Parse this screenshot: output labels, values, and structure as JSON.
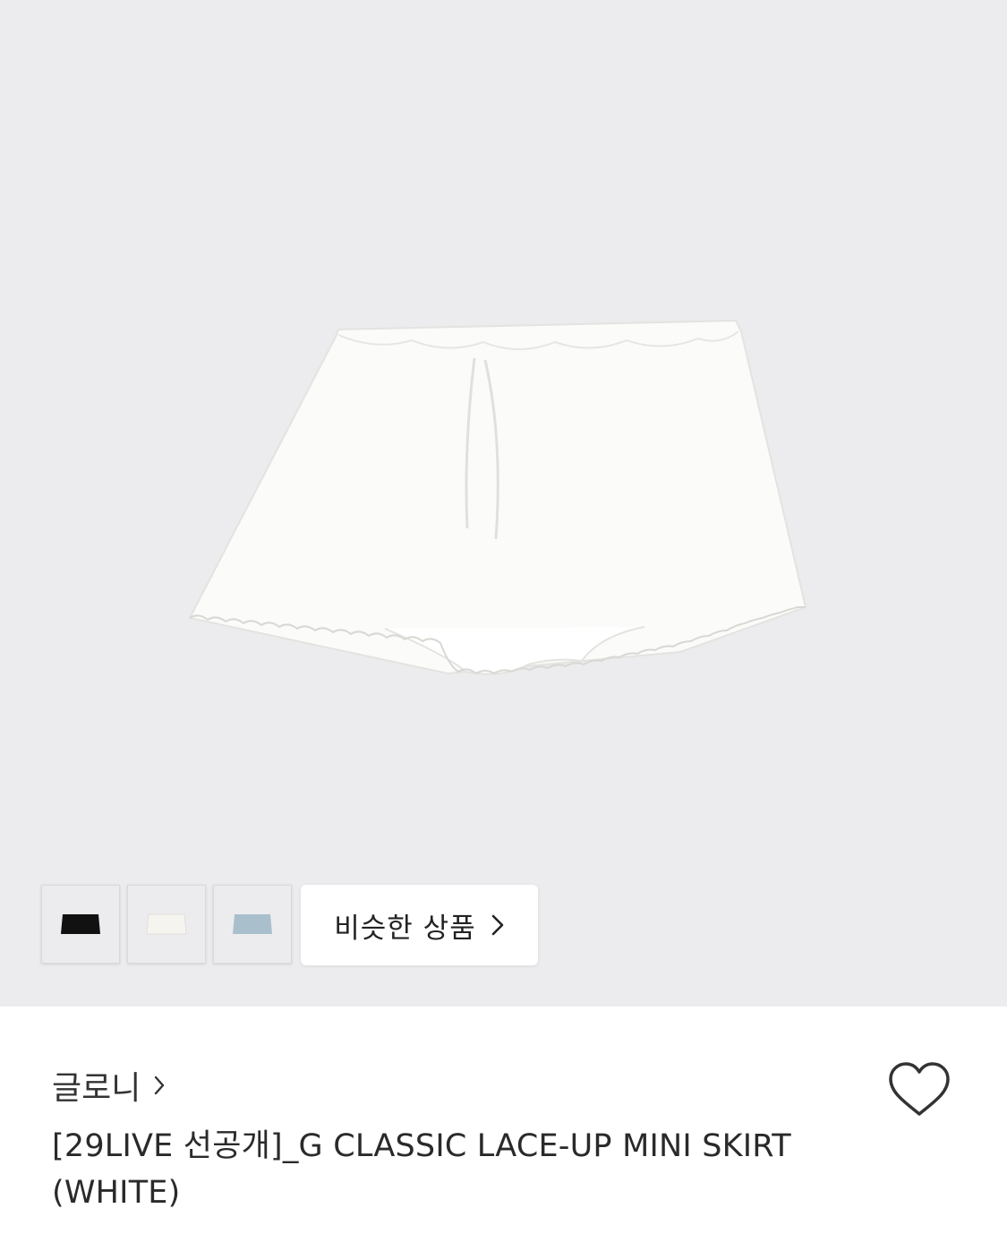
{
  "gallery": {
    "similar_label": "비슷한 상품",
    "thumbnails": [
      {
        "color": "#111111"
      },
      {
        "color": "#f6f4ef"
      },
      {
        "color": "#a9bfcc"
      }
    ],
    "background": "#ececee"
  },
  "product": {
    "brand": "글로니",
    "title": "[29LIVE 선공개]_G CLASSIC LACE-UP MINI SKIRT (WHITE)",
    "image_icon": "white-mini-skirt"
  }
}
